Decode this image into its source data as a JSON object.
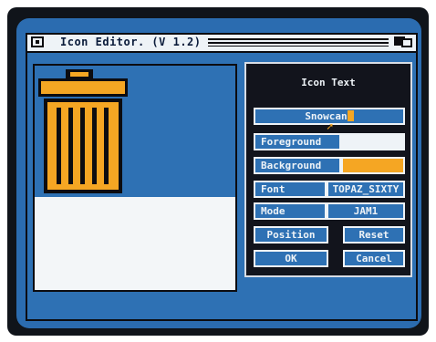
{
  "window": {
    "title": "Icon Editor.  (V 1.2)"
  },
  "requester": {
    "title": "Icon Text",
    "text_value": "Snowcan",
    "foreground_label": "Foreground",
    "background_label": "Background",
    "font_label": "Font",
    "font_value": "TOPAZ_SIXTY",
    "mode_label": "Mode",
    "mode_value": "JAM1",
    "position_label": "Position",
    "reset_label": "Reset",
    "ok_label": "OK",
    "cancel_label": "Cancel"
  },
  "colors": {
    "screen_blue": "#2e71b4",
    "foreground": "#eef3f7",
    "background": "#f5a623",
    "ink": "#0c0c10"
  },
  "icons": {
    "close": "close-gadget-icon",
    "depth": "depth-gadget-icon",
    "canvas_icon": "trash-can-icon",
    "pointer": "mouse-pointer-icon"
  }
}
